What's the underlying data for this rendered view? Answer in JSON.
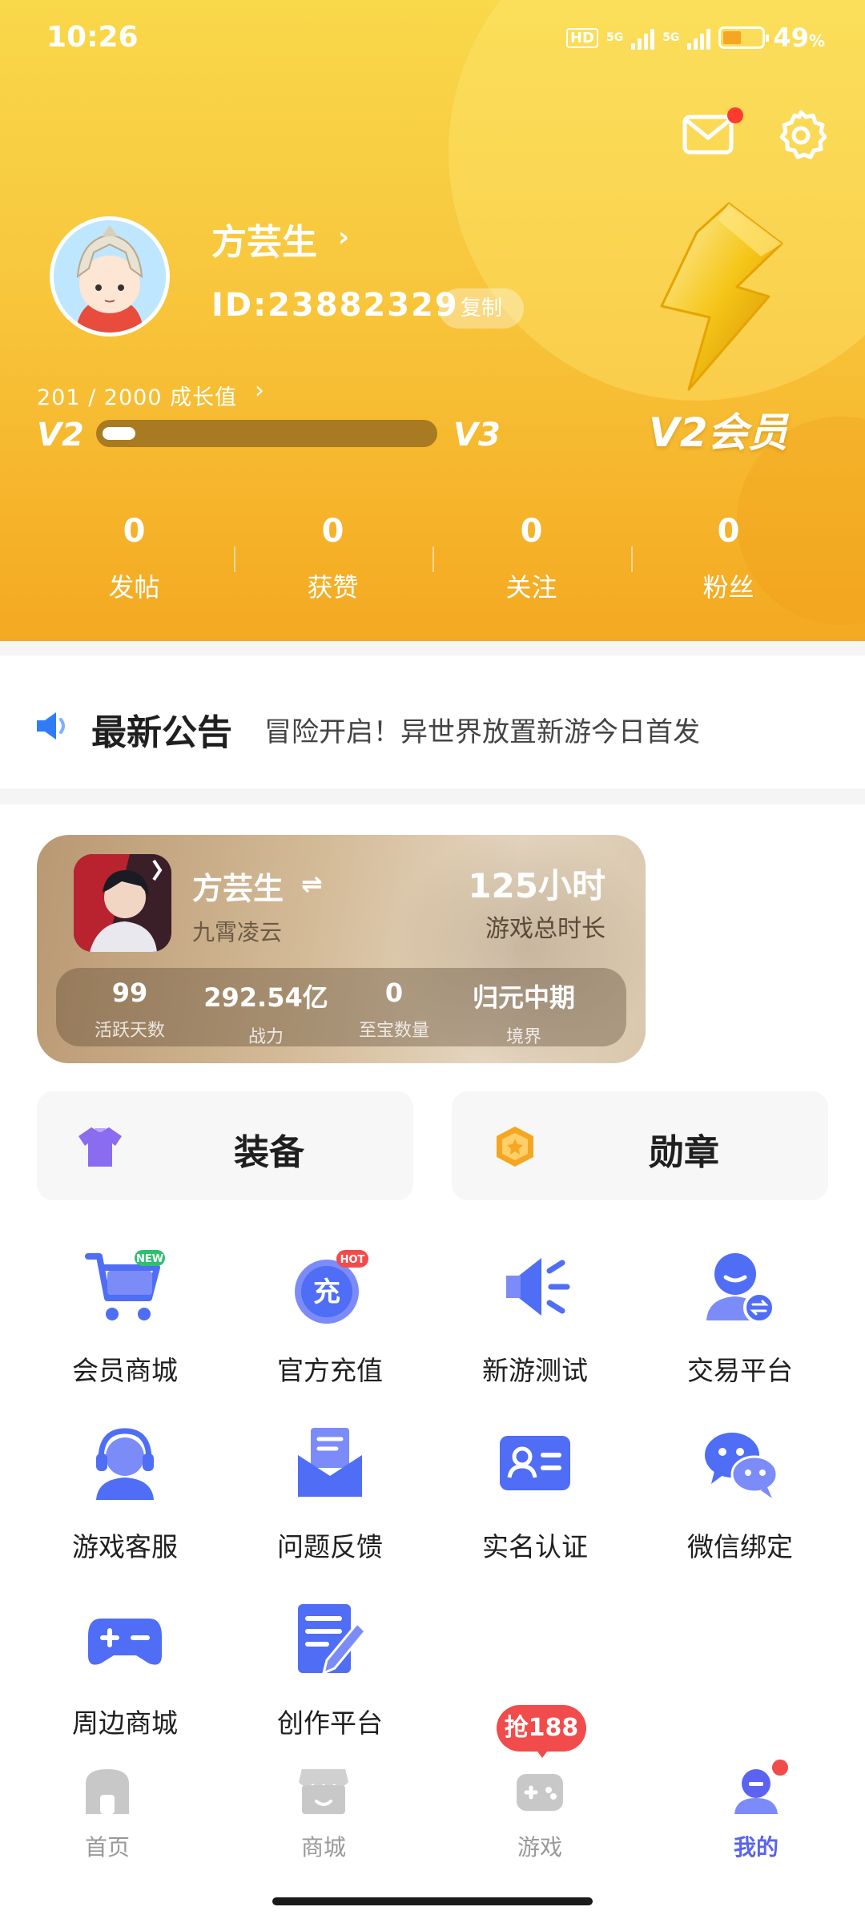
{
  "status_bar": {
    "time": "10:26",
    "network_badge": "HD",
    "network_1": "5G",
    "network_2": "5G",
    "battery_percent": "49",
    "battery_unit": "%"
  },
  "header": {
    "icons": [
      "mail-icon",
      "gear-icon"
    ],
    "user_name": "方芸生",
    "user_id": "ID:23882329",
    "copy_label": "复制",
    "growth_text": "201 / 2000 成长值",
    "growth_current": 201,
    "growth_total": 2000,
    "level_current": "V2",
    "level_next": "V3",
    "member_label": "V2会员",
    "accent_color": "#f8c63c"
  },
  "stats": [
    {
      "value": "0",
      "label": "发帖"
    },
    {
      "value": "0",
      "label": "获赞"
    },
    {
      "value": "0",
      "label": "关注"
    },
    {
      "value": "0",
      "label": "粉丝"
    }
  ],
  "notice": {
    "icon": "speaker-icon",
    "title": "最新公告",
    "text": "冒险开启！异世界放置新游今日首发"
  },
  "game_card": {
    "player_name": "方芸生",
    "game_name": "九霄凌云",
    "play_hours": "125小时",
    "play_hours_label": "游戏总时长",
    "stats": [
      {
        "value": "99",
        "label": "活跃天数"
      },
      {
        "value": "292.54亿",
        "label": "战力"
      },
      {
        "value": "0",
        "label": "至宝数量"
      },
      {
        "value": "归元中期",
        "label": "境界"
      }
    ]
  },
  "tiles": [
    {
      "label": "装备",
      "icon": "shirt-icon"
    },
    {
      "label": "勋章",
      "icon": "medal-icon"
    }
  ],
  "grid": [
    {
      "label": "会员商城",
      "icon": "cart-icon",
      "badge": "NEW"
    },
    {
      "label": "官方充值",
      "icon": "recharge-icon",
      "badge": "HOT",
      "glyph": "充"
    },
    {
      "label": "新游测试",
      "icon": "megaphone-icon"
    },
    {
      "label": "交易平台",
      "icon": "trade-icon"
    },
    {
      "label": "游戏客服",
      "icon": "headset-icon"
    },
    {
      "label": "问题反馈",
      "icon": "feedback-icon"
    },
    {
      "label": "实名认证",
      "icon": "id-card-icon"
    },
    {
      "label": "微信绑定",
      "icon": "wechat-icon"
    },
    {
      "label": "周边商城",
      "icon": "gamepad-icon"
    },
    {
      "label": "创作平台",
      "icon": "edit-doc-icon"
    }
  ],
  "bottom_nav": {
    "items": [
      {
        "label": "首页",
        "icon": "home-icon"
      },
      {
        "label": "商城",
        "icon": "store-icon"
      },
      {
        "label": "游戏",
        "icon": "game-icon"
      },
      {
        "label": "我的",
        "icon": "profile-icon"
      }
    ],
    "active_index": 3,
    "promo_badge": "抢188",
    "active_color": "#5b63f0"
  }
}
